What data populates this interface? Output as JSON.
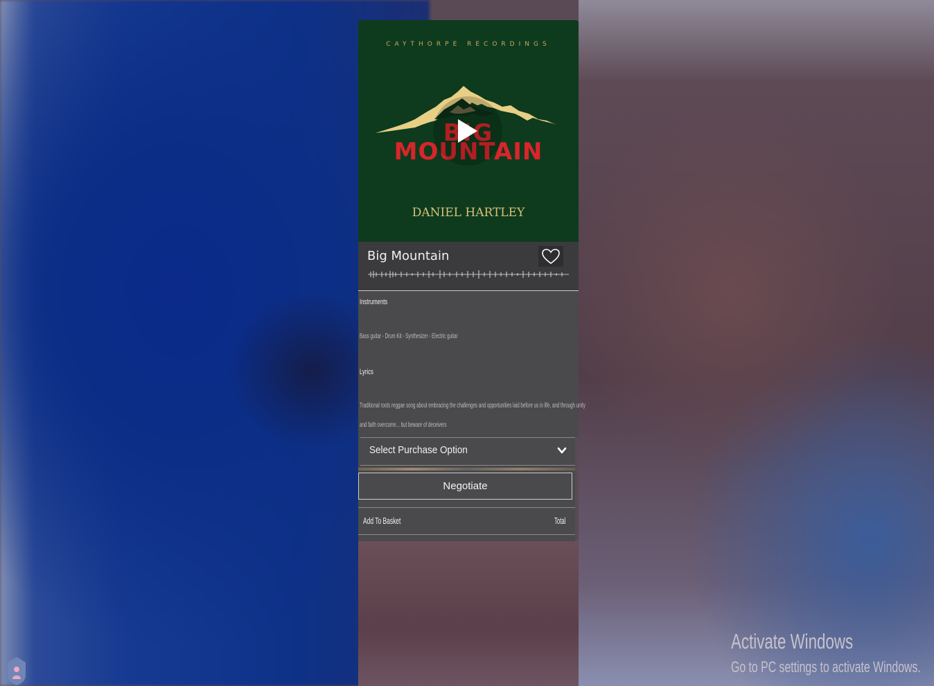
{
  "album": {
    "label": "CAYTHORPE RECORDINGS",
    "title_line1": "BIG",
    "title_line2": "MOUNTAIN",
    "artist": "DANIEL HARTLEY"
  },
  "track": {
    "title": "Big Mountain"
  },
  "details": {
    "instruments_heading": "Instruments",
    "instruments_text": "Bass guitar - Drum Kit - Synthesizer - Electric guitar",
    "lyrics_heading": "Lyrics",
    "lyrics_line1": "Traditional roots reggae song about embracing the challenges and opportunities laid before us in life, and through unity",
    "lyrics_line2": "and faith overcome... but beware of deceivers"
  },
  "purchase": {
    "select_label": "Select Purchase Option",
    "negotiate_label": "Negotiate",
    "add_to_basket_label": "Add To Basket",
    "total_label": "Total"
  },
  "watermark": {
    "line1": "Activate Windows",
    "line2": "Go to PC settings to activate Windows."
  },
  "icons": {
    "play": "play-icon",
    "heart": "heart-icon",
    "chevron": "chevron-down-icon",
    "corner": "user-shield-icon"
  },
  "colors": {
    "cover_bg": "#0e3b1e",
    "title_red": "#d9252a",
    "gold": "#d9c07a",
    "panel_bg": "#4a494c"
  }
}
